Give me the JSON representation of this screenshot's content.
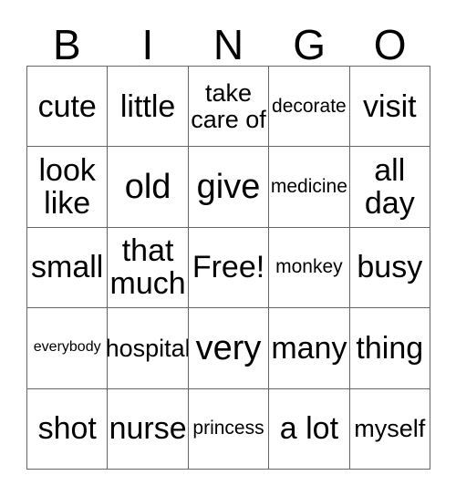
{
  "card": {
    "headers": [
      "B",
      "I",
      "N",
      "G",
      "O"
    ],
    "rows": [
      [
        {
          "text": "cute",
          "size": "fs-xl"
        },
        {
          "text": "little",
          "size": "fs-xl"
        },
        {
          "text": "take\ncare of",
          "size": "fs-md"
        },
        {
          "text": "decorate",
          "size": "fs-sm"
        },
        {
          "text": "visit",
          "size": "fs-xl"
        }
      ],
      [
        {
          "text": "look\nlike",
          "size": "fs-xl"
        },
        {
          "text": "old",
          "size": "fs-xxl"
        },
        {
          "text": "give",
          "size": "fs-xxl"
        },
        {
          "text": "medicine",
          "size": "fs-sm"
        },
        {
          "text": "all\nday",
          "size": "fs-xl"
        }
      ],
      [
        {
          "text": "small",
          "size": "fs-xl"
        },
        {
          "text": "that\nmuch",
          "size": "fs-xl"
        },
        {
          "text": "Free!",
          "size": "fs-xl"
        },
        {
          "text": "monkey",
          "size": "fs-sm"
        },
        {
          "text": "busy",
          "size": "fs-xl"
        }
      ],
      [
        {
          "text": "everybody",
          "size": "fs-xs"
        },
        {
          "text": "hospital",
          "size": "fs-md"
        },
        {
          "text": "very",
          "size": "fs-xxl"
        },
        {
          "text": "many",
          "size": "fs-xl"
        },
        {
          "text": "thing",
          "size": "fs-xl"
        }
      ],
      [
        {
          "text": "shot",
          "size": "fs-xl"
        },
        {
          "text": "nurse",
          "size": "fs-xl"
        },
        {
          "text": "princess",
          "size": "fs-sm"
        },
        {
          "text": "a lot",
          "size": "fs-xl"
        },
        {
          "text": "myself",
          "size": "fs-md"
        }
      ]
    ],
    "free_space": "Free!",
    "colors": {
      "background": "#ffffff",
      "border": "#666666",
      "text": "#000000"
    }
  }
}
